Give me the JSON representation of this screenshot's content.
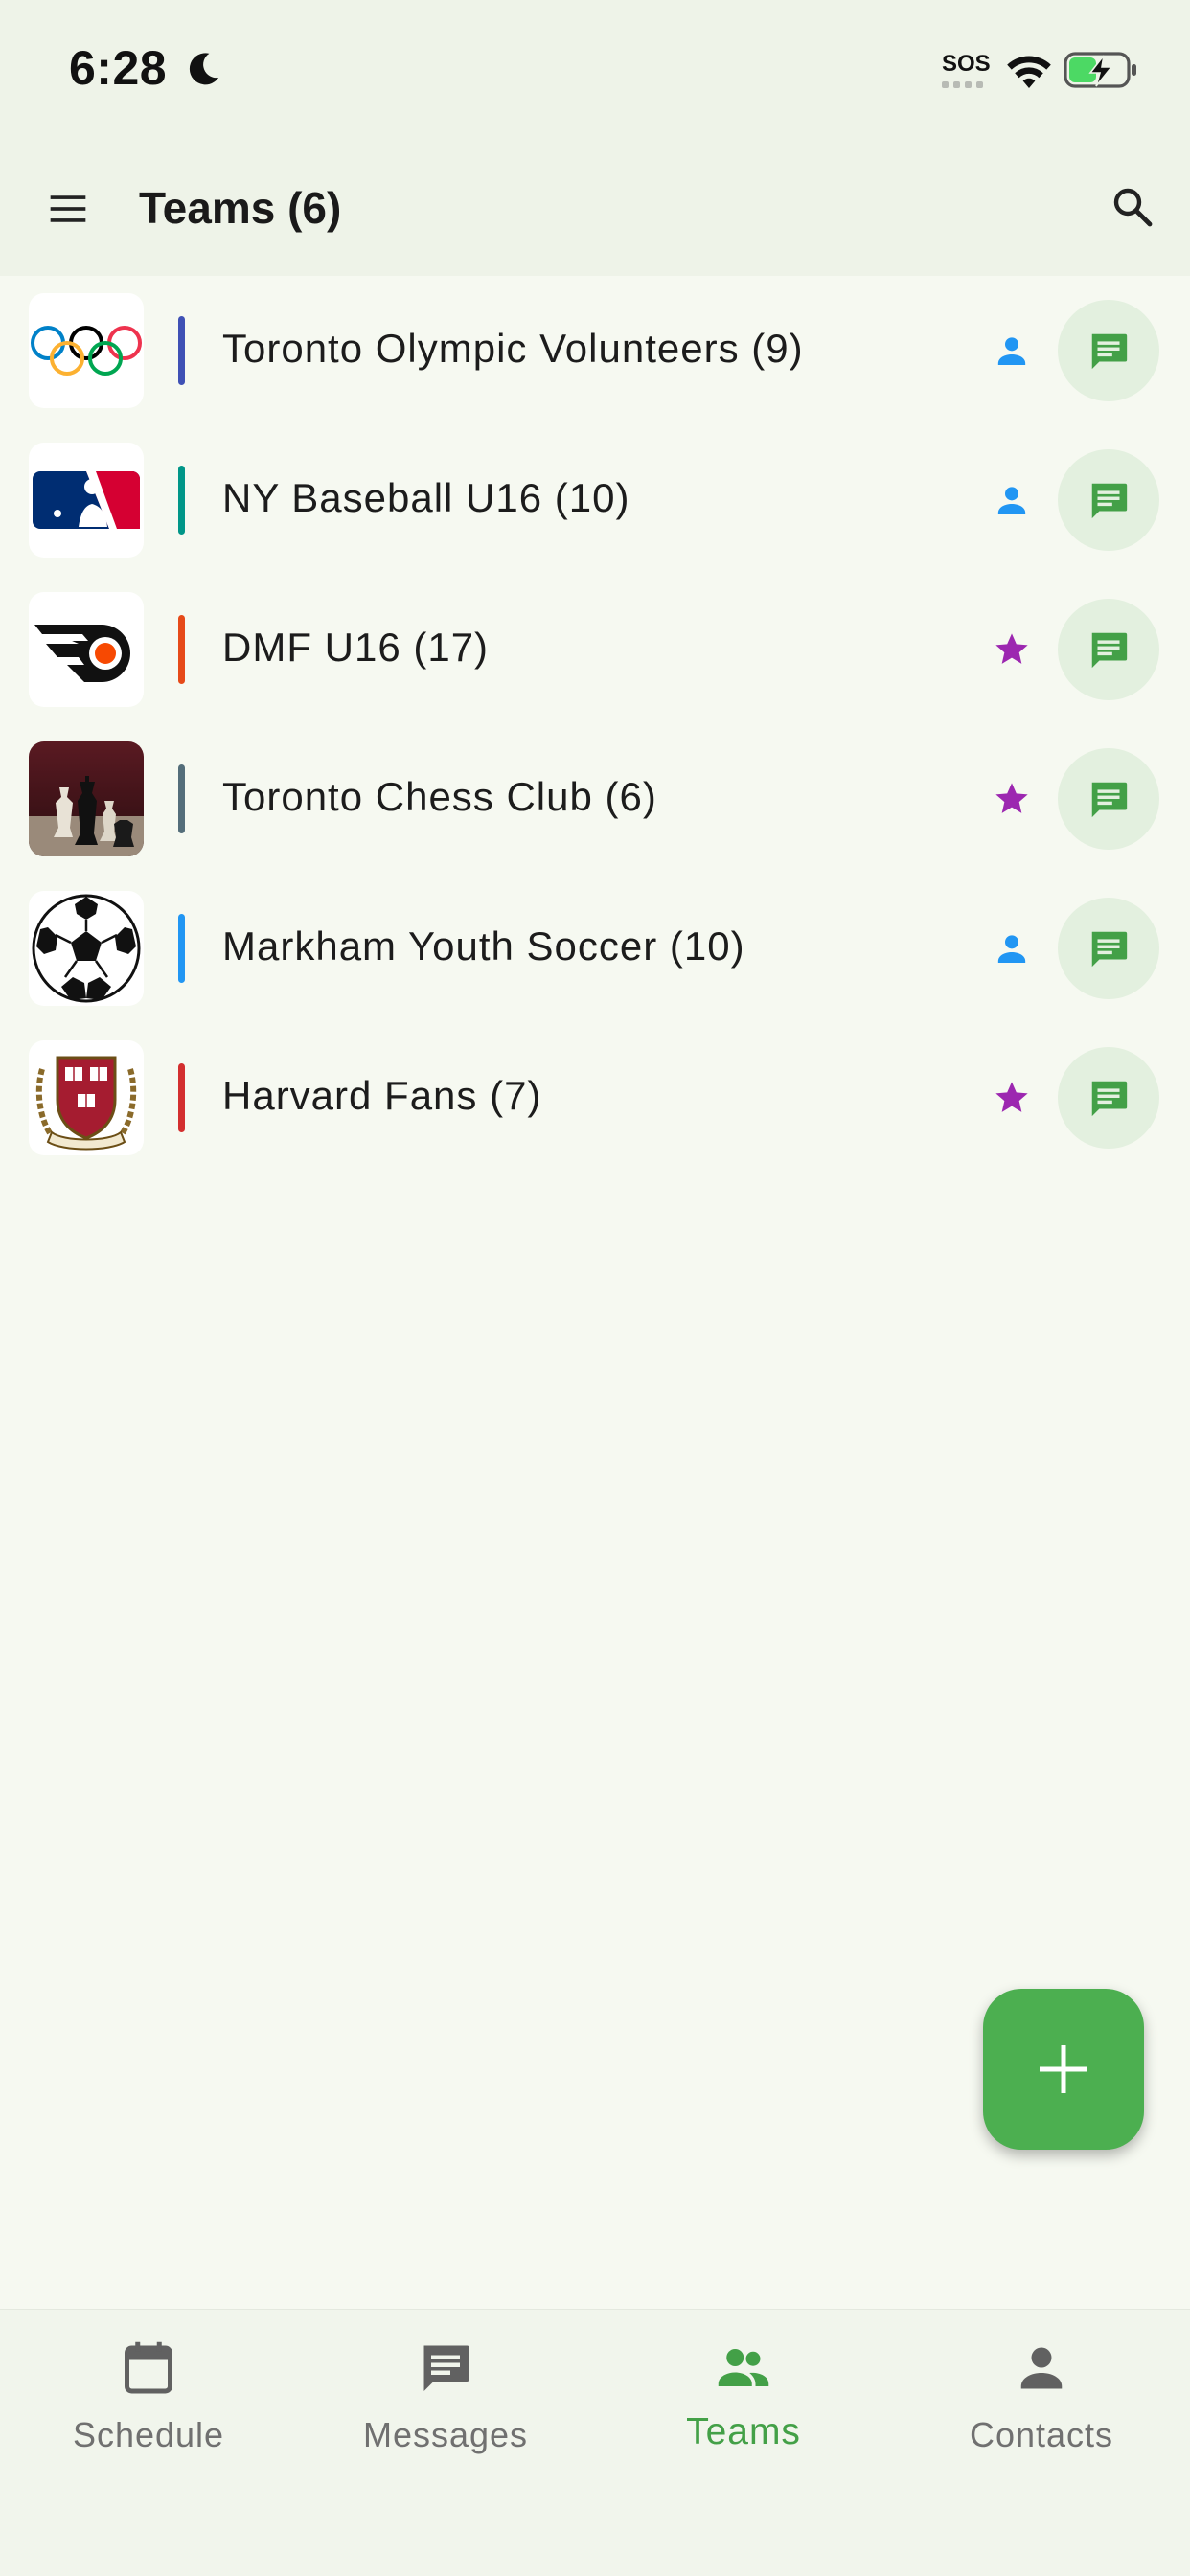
{
  "status_bar": {
    "time": "6:28",
    "sos": "SOS"
  },
  "app_bar": {
    "title": "Teams (6)"
  },
  "teams": [
    {
      "name": "Toronto Olympic Volunteers (9)",
      "color": "#3f51b5",
      "logo": "olympic-rings-logo",
      "role_icon": "person-icon",
      "role_color": "#2196f3"
    },
    {
      "name": "NY Baseball U16 (10)",
      "color": "#009688",
      "logo": "baseball-logo",
      "role_icon": "person-icon",
      "role_color": "#2196f3"
    },
    {
      "name": "DMF U16 (17)",
      "color": "#e64a19",
      "logo": "flyers-logo",
      "role_icon": "star-icon",
      "role_color": "#9c27b0"
    },
    {
      "name": "Toronto Chess Club (6)",
      "color": "#546e7a",
      "logo": "chess-logo",
      "role_icon": "star-icon",
      "role_color": "#9c27b0"
    },
    {
      "name": "Markham Youth Soccer (10)",
      "color": "#2196f3",
      "logo": "soccer-ball-logo",
      "role_icon": "person-icon",
      "role_color": "#2196f3"
    },
    {
      "name": "Harvard Fans (7)",
      "color": "#d32f2f",
      "logo": "harvard-crest-logo",
      "role_icon": "star-icon",
      "role_color": "#9c27b0"
    }
  ],
  "bottom_nav": {
    "items": [
      {
        "label": "Schedule",
        "icon": "calendar-icon",
        "active": false
      },
      {
        "label": "Messages",
        "icon": "message-icon",
        "active": false
      },
      {
        "label": "Teams",
        "icon": "people-icon",
        "active": true
      },
      {
        "label": "Contacts",
        "icon": "person-icon",
        "active": false
      }
    ]
  },
  "colors": {
    "accent": "#4caf50",
    "active_nav": "#43a047",
    "chat_bubble_bg": "#e3f0df",
    "background": "#f6f9f1"
  }
}
